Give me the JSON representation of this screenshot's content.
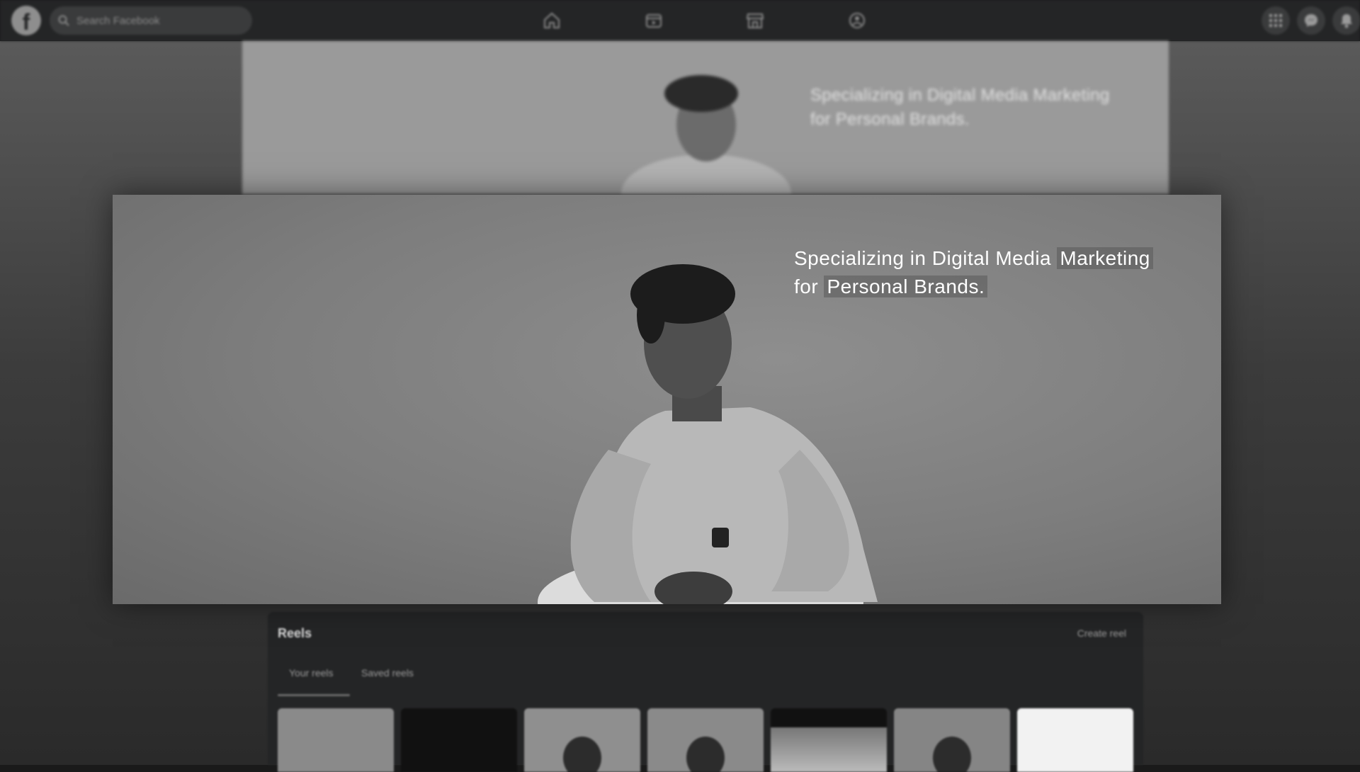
{
  "topbar": {
    "logo_letter": "f",
    "search_placeholder": "Search Facebook",
    "nav_icons": [
      "home-icon",
      "video-icon",
      "marketplace-icon",
      "groups-icon"
    ],
    "right_icons": [
      "menu-grid-icon",
      "messenger-icon",
      "notifications-icon"
    ]
  },
  "background_cover": {
    "text_line1": "Specializing in Digital Media Marketing",
    "text_line2": "for Personal Brands."
  },
  "cover_photo": {
    "text_line1_plain": "Specializing in Digital Media ",
    "text_line1_highlight": "Marketing",
    "text_line2_plain": "for ",
    "text_line2_highlight": "Personal Brands."
  },
  "reels": {
    "title": "Reels",
    "create_label": "Create reel",
    "tabs": [
      "Your reels",
      "Saved reels"
    ],
    "active_tab": "Your reels",
    "thumbnail_count": 7
  },
  "colors": {
    "topbar_bg": "#242526",
    "panel_bg": "#242526",
    "overlay_text": "#ffffff"
  }
}
